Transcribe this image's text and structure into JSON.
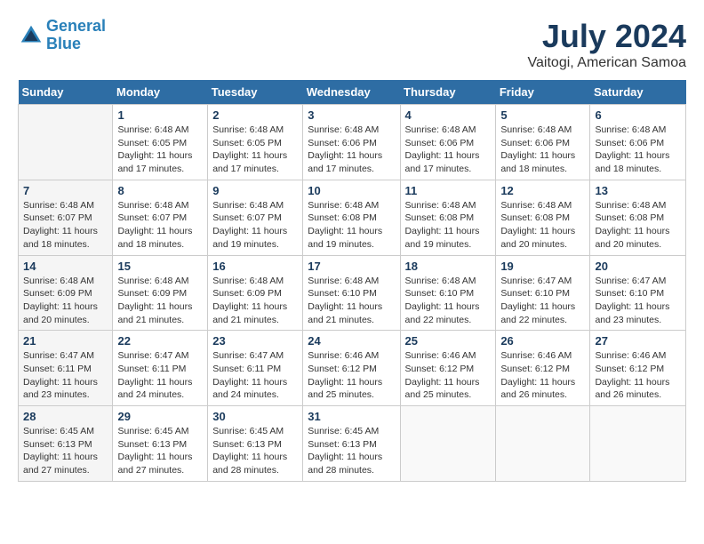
{
  "header": {
    "logo_line1": "General",
    "logo_line2": "Blue",
    "month_year": "July 2024",
    "location": "Vaitogi, American Samoa"
  },
  "days_of_week": [
    "Sunday",
    "Monday",
    "Tuesday",
    "Wednesday",
    "Thursday",
    "Friday",
    "Saturday"
  ],
  "weeks": [
    [
      {
        "day": "",
        "sunrise": "",
        "sunset": "",
        "daylight": ""
      },
      {
        "day": "1",
        "sunrise": "Sunrise: 6:48 AM",
        "sunset": "Sunset: 6:05 PM",
        "daylight": "Daylight: 11 hours and 17 minutes."
      },
      {
        "day": "2",
        "sunrise": "Sunrise: 6:48 AM",
        "sunset": "Sunset: 6:05 PM",
        "daylight": "Daylight: 11 hours and 17 minutes."
      },
      {
        "day": "3",
        "sunrise": "Sunrise: 6:48 AM",
        "sunset": "Sunset: 6:06 PM",
        "daylight": "Daylight: 11 hours and 17 minutes."
      },
      {
        "day": "4",
        "sunrise": "Sunrise: 6:48 AM",
        "sunset": "Sunset: 6:06 PM",
        "daylight": "Daylight: 11 hours and 17 minutes."
      },
      {
        "day": "5",
        "sunrise": "Sunrise: 6:48 AM",
        "sunset": "Sunset: 6:06 PM",
        "daylight": "Daylight: 11 hours and 18 minutes."
      },
      {
        "day": "6",
        "sunrise": "Sunrise: 6:48 AM",
        "sunset": "Sunset: 6:06 PM",
        "daylight": "Daylight: 11 hours and 18 minutes."
      }
    ],
    [
      {
        "day": "7",
        "sunrise": "Sunrise: 6:48 AM",
        "sunset": "Sunset: 6:07 PM",
        "daylight": "Daylight: 11 hours and 18 minutes."
      },
      {
        "day": "8",
        "sunrise": "Sunrise: 6:48 AM",
        "sunset": "Sunset: 6:07 PM",
        "daylight": "Daylight: 11 hours and 18 minutes."
      },
      {
        "day": "9",
        "sunrise": "Sunrise: 6:48 AM",
        "sunset": "Sunset: 6:07 PM",
        "daylight": "Daylight: 11 hours and 19 minutes."
      },
      {
        "day": "10",
        "sunrise": "Sunrise: 6:48 AM",
        "sunset": "Sunset: 6:08 PM",
        "daylight": "Daylight: 11 hours and 19 minutes."
      },
      {
        "day": "11",
        "sunrise": "Sunrise: 6:48 AM",
        "sunset": "Sunset: 6:08 PM",
        "daylight": "Daylight: 11 hours and 19 minutes."
      },
      {
        "day": "12",
        "sunrise": "Sunrise: 6:48 AM",
        "sunset": "Sunset: 6:08 PM",
        "daylight": "Daylight: 11 hours and 20 minutes."
      },
      {
        "day": "13",
        "sunrise": "Sunrise: 6:48 AM",
        "sunset": "Sunset: 6:08 PM",
        "daylight": "Daylight: 11 hours and 20 minutes."
      }
    ],
    [
      {
        "day": "14",
        "sunrise": "Sunrise: 6:48 AM",
        "sunset": "Sunset: 6:09 PM",
        "daylight": "Daylight: 11 hours and 20 minutes."
      },
      {
        "day": "15",
        "sunrise": "Sunrise: 6:48 AM",
        "sunset": "Sunset: 6:09 PM",
        "daylight": "Daylight: 11 hours and 21 minutes."
      },
      {
        "day": "16",
        "sunrise": "Sunrise: 6:48 AM",
        "sunset": "Sunset: 6:09 PM",
        "daylight": "Daylight: 11 hours and 21 minutes."
      },
      {
        "day": "17",
        "sunrise": "Sunrise: 6:48 AM",
        "sunset": "Sunset: 6:10 PM",
        "daylight": "Daylight: 11 hours and 21 minutes."
      },
      {
        "day": "18",
        "sunrise": "Sunrise: 6:48 AM",
        "sunset": "Sunset: 6:10 PM",
        "daylight": "Daylight: 11 hours and 22 minutes."
      },
      {
        "day": "19",
        "sunrise": "Sunrise: 6:47 AM",
        "sunset": "Sunset: 6:10 PM",
        "daylight": "Daylight: 11 hours and 22 minutes."
      },
      {
        "day": "20",
        "sunrise": "Sunrise: 6:47 AM",
        "sunset": "Sunset: 6:10 PM",
        "daylight": "Daylight: 11 hours and 23 minutes."
      }
    ],
    [
      {
        "day": "21",
        "sunrise": "Sunrise: 6:47 AM",
        "sunset": "Sunset: 6:11 PM",
        "daylight": "Daylight: 11 hours and 23 minutes."
      },
      {
        "day": "22",
        "sunrise": "Sunrise: 6:47 AM",
        "sunset": "Sunset: 6:11 PM",
        "daylight": "Daylight: 11 hours and 24 minutes."
      },
      {
        "day": "23",
        "sunrise": "Sunrise: 6:47 AM",
        "sunset": "Sunset: 6:11 PM",
        "daylight": "Daylight: 11 hours and 24 minutes."
      },
      {
        "day": "24",
        "sunrise": "Sunrise: 6:46 AM",
        "sunset": "Sunset: 6:12 PM",
        "daylight": "Daylight: 11 hours and 25 minutes."
      },
      {
        "day": "25",
        "sunrise": "Sunrise: 6:46 AM",
        "sunset": "Sunset: 6:12 PM",
        "daylight": "Daylight: 11 hours and 25 minutes."
      },
      {
        "day": "26",
        "sunrise": "Sunrise: 6:46 AM",
        "sunset": "Sunset: 6:12 PM",
        "daylight": "Daylight: 11 hours and 26 minutes."
      },
      {
        "day": "27",
        "sunrise": "Sunrise: 6:46 AM",
        "sunset": "Sunset: 6:12 PM",
        "daylight": "Daylight: 11 hours and 26 minutes."
      }
    ],
    [
      {
        "day": "28",
        "sunrise": "Sunrise: 6:45 AM",
        "sunset": "Sunset: 6:13 PM",
        "daylight": "Daylight: 11 hours and 27 minutes."
      },
      {
        "day": "29",
        "sunrise": "Sunrise: 6:45 AM",
        "sunset": "Sunset: 6:13 PM",
        "daylight": "Daylight: 11 hours and 27 minutes."
      },
      {
        "day": "30",
        "sunrise": "Sunrise: 6:45 AM",
        "sunset": "Sunset: 6:13 PM",
        "daylight": "Daylight: 11 hours and 28 minutes."
      },
      {
        "day": "31",
        "sunrise": "Sunrise: 6:45 AM",
        "sunset": "Sunset: 6:13 PM",
        "daylight": "Daylight: 11 hours and 28 minutes."
      },
      {
        "day": "",
        "sunrise": "",
        "sunset": "",
        "daylight": ""
      },
      {
        "day": "",
        "sunrise": "",
        "sunset": "",
        "daylight": ""
      },
      {
        "day": "",
        "sunrise": "",
        "sunset": "",
        "daylight": ""
      }
    ]
  ]
}
